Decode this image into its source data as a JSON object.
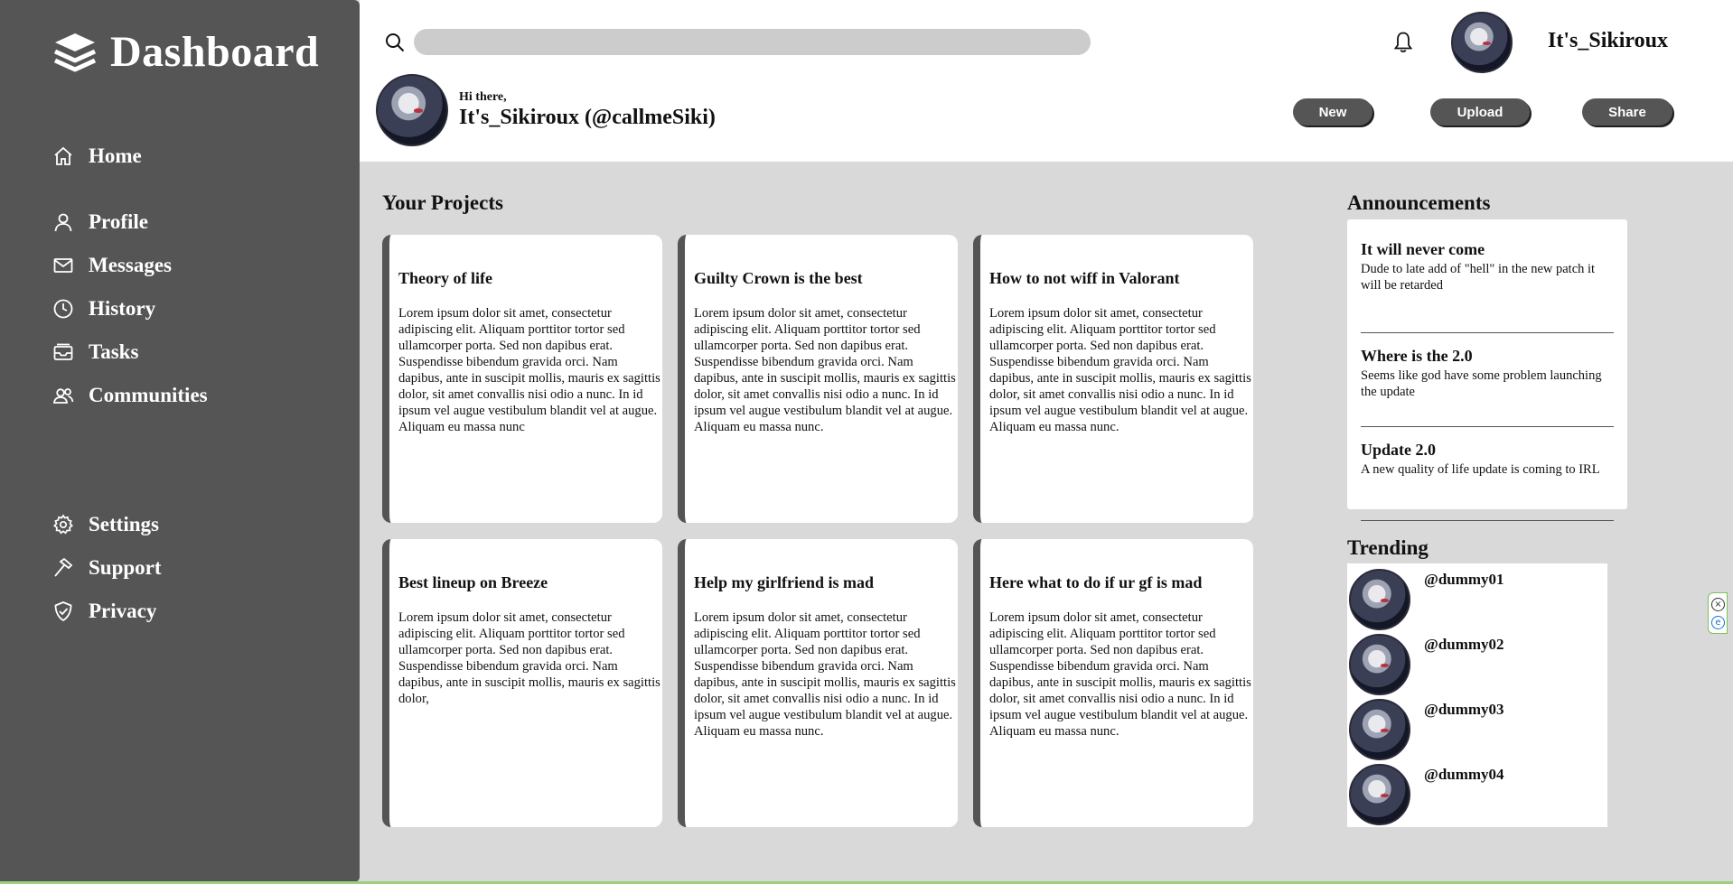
{
  "sidebar": {
    "brand": "Dashboard",
    "nav": [
      {
        "label": "Home",
        "icon": "home-icon"
      },
      {
        "label": "Profile",
        "icon": "user-icon"
      },
      {
        "label": "Messages",
        "icon": "mail-icon"
      },
      {
        "label": "History",
        "icon": "clock-icon"
      },
      {
        "label": "Tasks",
        "icon": "inbox-icon"
      },
      {
        "label": "Communities",
        "icon": "users-icon"
      }
    ],
    "bottom_nav": [
      {
        "label": "Settings",
        "icon": "gear-icon"
      },
      {
        "label": "Support",
        "icon": "hammer-icon"
      },
      {
        "label": "Privacy",
        "icon": "shield-icon"
      }
    ]
  },
  "header": {
    "search_placeholder": "",
    "username": "It's_Sikiroux",
    "greeting": "Hi there,",
    "display_name": "It's_Sikiroux (@callmeSiki)",
    "buttons": {
      "new": "New",
      "upload": "Upload",
      "share": "Share"
    }
  },
  "projects": {
    "title": "Your Projects",
    "cards": [
      {
        "title": "Theory of life",
        "body": "Lorem ipsum dolor sit amet, consectetur adipiscing elit. Aliquam porttitor tortor sed ullamcorper porta. Sed non dapibus erat. Suspendisse bibendum gravida orci. Nam dapibus, ante in suscipit mollis, mauris ex sagittis dolor, sit amet convallis nisi odio a nunc. In id ipsum vel augue vestibulum blandit vel at augue. Aliquam eu massa nunc"
      },
      {
        "title": "Guilty Crown is the best",
        "body": "Lorem ipsum dolor sit amet, consectetur adipiscing elit. Aliquam porttitor tortor sed ullamcorper porta. Sed non dapibus erat. Suspendisse bibendum gravida orci. Nam dapibus, ante in suscipit mollis, mauris ex sagittis dolor, sit amet convallis nisi odio a nunc. In id ipsum vel augue vestibulum blandit vel at augue. Aliquam eu massa nunc."
      },
      {
        "title": "How to not wiff in Valorant",
        "body": "Lorem ipsum dolor sit amet, consectetur adipiscing elit. Aliquam porttitor tortor sed ullamcorper porta. Sed non dapibus erat. Suspendisse bibendum gravida orci. Nam dapibus, ante in suscipit mollis, mauris ex sagittis dolor, sit amet convallis nisi odio a nunc. In id ipsum vel augue vestibulum blandit vel at augue. Aliquam eu massa nunc."
      },
      {
        "title": "Best lineup on Breeze",
        "body": "Lorem ipsum dolor sit amet, consectetur adipiscing elit. Aliquam porttitor tortor sed ullamcorper porta. Sed non dapibus erat. Suspendisse bibendum gravida orci. Nam dapibus, ante in suscipit mollis, mauris ex sagittis dolor,"
      },
      {
        "title": "Help my girlfriend is mad",
        "body": "Lorem ipsum dolor sit amet, consectetur adipiscing elit. Aliquam porttitor tortor sed ullamcorper porta. Sed non dapibus erat. Suspendisse bibendum gravida orci. Nam dapibus, ante in suscipit mollis, mauris ex sagittis dolor, sit amet convallis nisi odio a nunc. In id ipsum vel augue vestibulum blandit vel at augue. Aliquam eu massa nunc."
      },
      {
        "title": "Here what to do if ur gf is mad",
        "body": "Lorem ipsum dolor sit amet, consectetur adipiscing elit. Aliquam porttitor tortor sed ullamcorper porta. Sed non dapibus erat. Suspendisse bibendum gravida orci. Nam dapibus, ante in suscipit mollis, mauris ex sagittis dolor, sit amet convallis nisi odio a nunc. In id ipsum vel augue vestibulum blandit vel at augue. Aliquam eu massa nunc."
      }
    ]
  },
  "announcements": {
    "title": "Announcements",
    "items": [
      {
        "title": "It will never come",
        "body": "Dude to late add of \"hell\" in the new patch it will be retarded"
      },
      {
        "title": "Where is the 2.0",
        "body": "Seems like god have some problem launching the update"
      },
      {
        "title": "Update 2.0",
        "body": "A new quality of life update is coming to IRL"
      }
    ]
  },
  "trending": {
    "title": "Trending",
    "users": [
      "@dummy01",
      "@dummy02",
      "@dummy03",
      "@dummy04"
    ]
  },
  "colors": {
    "sidebar_bg": "#555555",
    "page_bg": "#d9d9d9",
    "accent_border": "#9bd07e"
  }
}
